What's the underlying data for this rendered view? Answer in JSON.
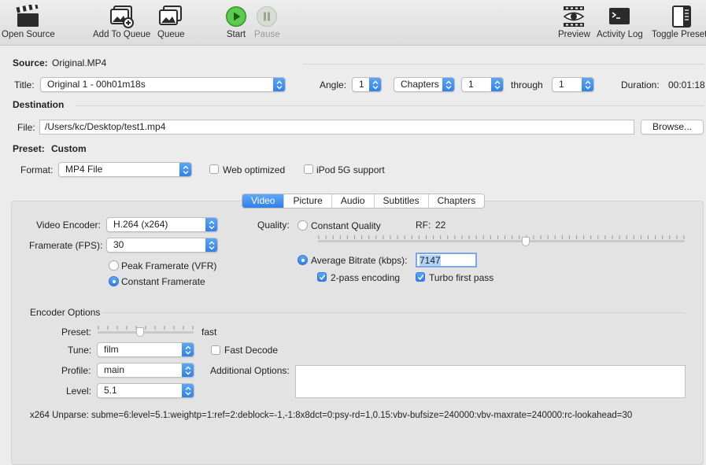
{
  "toolbar": {
    "open_source": "Open Source",
    "add_to_queue": "Add To Queue",
    "queue": "Queue",
    "start": "Start",
    "pause": "Pause",
    "preview": "Preview",
    "activity_log": "Activity Log",
    "toggle_presets": "Toggle Presets"
  },
  "source": {
    "label": "Source:",
    "value": "Original.MP4"
  },
  "title": {
    "label": "Title:",
    "value": "Original 1 - 00h01m18s"
  },
  "angle": {
    "label": "Angle:",
    "value": "1"
  },
  "range": {
    "mode": "Chapters",
    "start": "1",
    "through": "through",
    "end": "1"
  },
  "duration": {
    "label": "Duration:",
    "value": "00:01:18"
  },
  "destination": {
    "heading": "Destination",
    "file_label": "File:",
    "file_path": "/Users/kc/Desktop/test1.mp4",
    "browse": "Browse..."
  },
  "preset": {
    "label": "Preset:",
    "value": "Custom"
  },
  "format": {
    "label": "Format:",
    "value": "MP4 File",
    "web_optimized": "Web optimized",
    "ipod": "iPod 5G support"
  },
  "tabs": [
    "Video",
    "Picture",
    "Audio",
    "Subtitles",
    "Chapters"
  ],
  "video": {
    "encoder_label": "Video Encoder:",
    "encoder": "H.264 (x264)",
    "framerate_label": "Framerate (FPS):",
    "framerate": "30",
    "peak_vfr": "Peak Framerate (VFR)",
    "constant_fr": "Constant Framerate",
    "quality_label": "Quality:",
    "constant_quality": "Constant Quality",
    "rf_label": "RF:",
    "rf_value": "22",
    "avg_bitrate": "Average Bitrate (kbps):",
    "bitrate_value": "7147",
    "two_pass": "2-pass encoding",
    "turbo": "Turbo first pass"
  },
  "encoder_options": {
    "heading": "Encoder Options",
    "preset_label": "Preset:",
    "preset_value": "fast",
    "tune_label": "Tune:",
    "tune": "film",
    "fast_decode": "Fast Decode",
    "profile_label": "Profile:",
    "profile": "main",
    "additional_label": "Additional Options:",
    "level_label": "Level:",
    "level": "5.1",
    "unparse": "x264 Unparse: subme=6:level=5.1:weightp=1:ref=2:deblock=-1,-1:8x8dct=0:psy-rd=1,0.15:vbv-bufsize=240000:vbv-maxrate=240000:rc-lookahead=30"
  }
}
